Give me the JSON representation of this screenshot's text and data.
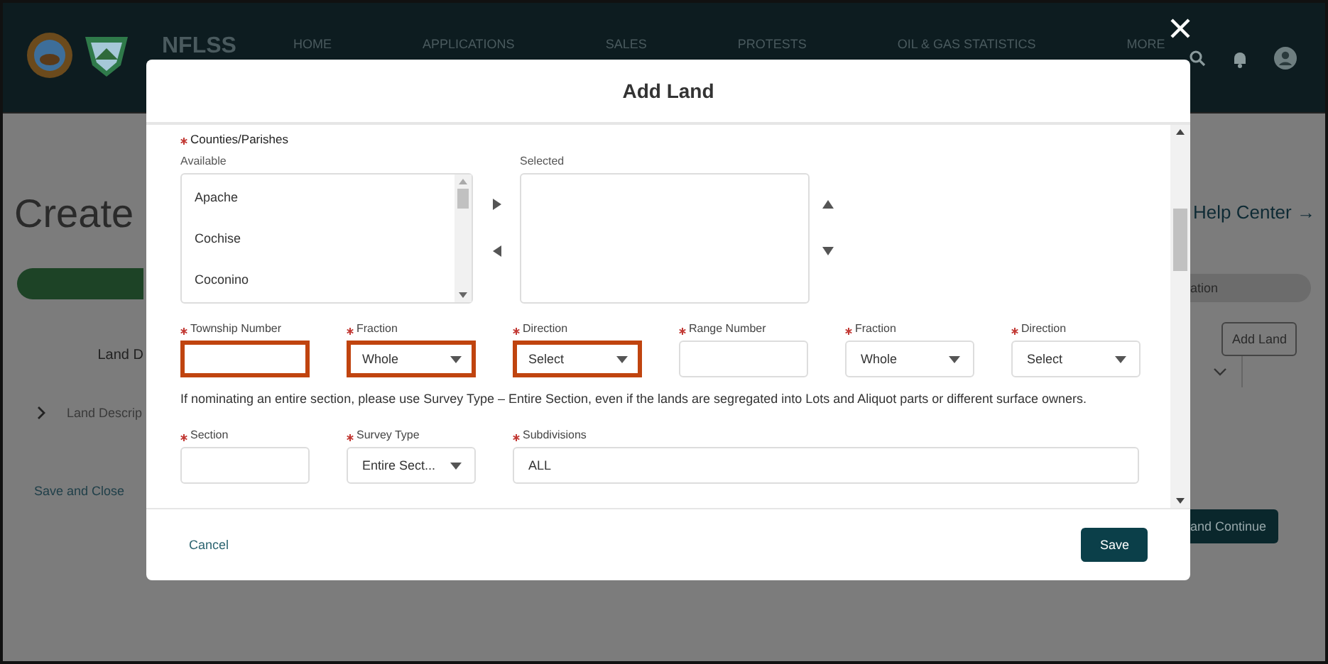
{
  "header": {
    "brand": "NFLSS",
    "nav": [
      "HOME",
      "APPLICATIONS",
      "SALES",
      "PROTESTS",
      "OIL & GAS STATISTICS",
      "MORE"
    ]
  },
  "page": {
    "title": "Create",
    "help_link": "Help Center →",
    "progress_label": "ation",
    "add_land_button": "Add Land",
    "table_header": "Land D",
    "row_label": "Land Descrip",
    "save_close": "Save and Close",
    "save_continue": "and Continue"
  },
  "modal": {
    "title": "Add Land",
    "counties": {
      "label": "Counties/Parishes",
      "required": true,
      "available_label": "Available",
      "available": [
        "Apache",
        "Cochise",
        "Coconino"
      ],
      "selected_label": "Selected"
    },
    "location_fields": [
      {
        "kind": "input",
        "label": "Township Number",
        "required": true,
        "highlighted": true
      },
      {
        "kind": "select",
        "label": "Fraction",
        "value": "Whole",
        "required": true,
        "highlighted": true
      },
      {
        "kind": "select",
        "label": "Direction",
        "value": "Select",
        "required": true,
        "highlighted": true
      },
      {
        "kind": "input",
        "label": "Range Number",
        "required": true,
        "highlighted": false
      },
      {
        "kind": "select",
        "label": "Fraction",
        "value": "Whole",
        "required": true,
        "highlighted": false
      },
      {
        "kind": "select",
        "label": "Direction",
        "value": "Select",
        "required": true,
        "highlighted": false
      }
    ],
    "note": "If nominating an entire section, please use Survey Type – Entire Section, even if the lands are segregated into Lots and Aliquot parts or different surface owners.",
    "section_fields": [
      {
        "kind": "input",
        "label": "Section",
        "required": true,
        "highlighted": false
      },
      {
        "kind": "select",
        "label": "Survey Type",
        "value": "Entire Sect...",
        "required": true,
        "highlighted": false
      },
      {
        "kind": "wide",
        "label": "Subdivisions",
        "value": "ALL",
        "required": true,
        "highlighted": false
      }
    ],
    "cancel": "Cancel",
    "save": "Save"
  }
}
